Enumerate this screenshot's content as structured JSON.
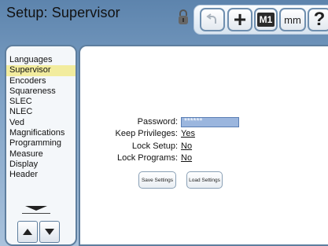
{
  "title": "Setup: Supervisor",
  "toolbar": {
    "undo_icon": "undo-icon",
    "cross_label": "+",
    "m1_label": "M1",
    "mm_label": "mm",
    "help_label": "?"
  },
  "menu": {
    "items": [
      "Languages",
      "Supervisor",
      "Encoders",
      "Squareness",
      "SLEC",
      "NLEC",
      "Ved",
      "Magnifications",
      "Programming",
      "Measure",
      "Display",
      "Header"
    ],
    "selected_index": 1
  },
  "form": {
    "password_label": "Password:",
    "password_value": "******",
    "keep_privileges_label": "Keep Privileges:",
    "keep_privileges_value": "Yes",
    "lock_setup_label": "Lock Setup:",
    "lock_setup_value": "No",
    "lock_programs_label": "Lock Programs:",
    "lock_programs_value": "No",
    "save_button": "Save Settings",
    "load_button": "Load Settings"
  },
  "colors": {
    "selected": "#f2ec9e",
    "frame": "#5e7e9e",
    "password_field": "#9bb6de"
  }
}
